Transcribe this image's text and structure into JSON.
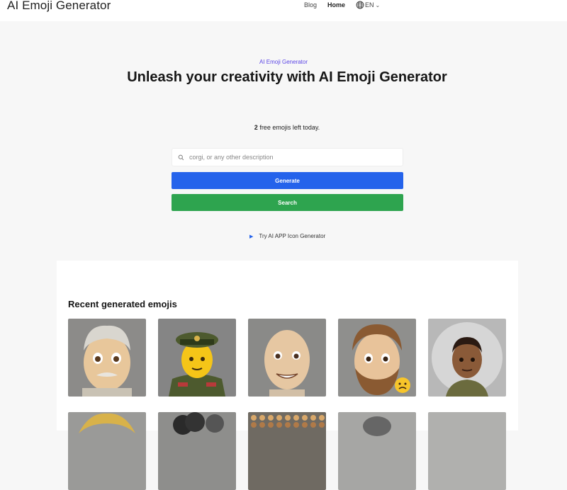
{
  "header": {
    "brand": "AI Emoji Generator",
    "nav": [
      {
        "label": "Blog"
      },
      {
        "label": "Home"
      }
    ],
    "language": "EN"
  },
  "hero": {
    "kicker": "AI Emoji Generator",
    "title": "Unleash your creativity with AI Emoji Generator"
  },
  "quota": {
    "count": "2",
    "text": " free emojis left today."
  },
  "search": {
    "placeholder": "corgi, or any other description",
    "value": ""
  },
  "actions": {
    "generate_label": "Generate",
    "search_label": "Search",
    "try_label": "Try AI APP Icon Generator"
  },
  "recent": {
    "title": "Recent generated emojis",
    "items": [
      {
        "icon": "emoji-elderly-man"
      },
      {
        "icon": "emoji-military-officer"
      },
      {
        "icon": "emoji-bald-man"
      },
      {
        "icon": "emoji-bearded-man-with-sad-badge"
      },
      {
        "icon": "emoji-young-man-dark-skin"
      },
      {
        "icon": "emoji-blond-hair"
      },
      {
        "icon": "emoji-dark-curly-hair"
      },
      {
        "icon": "emoji-sticker-sheet"
      },
      {
        "icon": "emoji-placeholder"
      },
      {
        "icon": "emoji-placeholder"
      }
    ]
  },
  "colors": {
    "accent_blue": "#2563eb",
    "search_green": "#2ea44f",
    "kicker_purple": "#5b45e6"
  }
}
